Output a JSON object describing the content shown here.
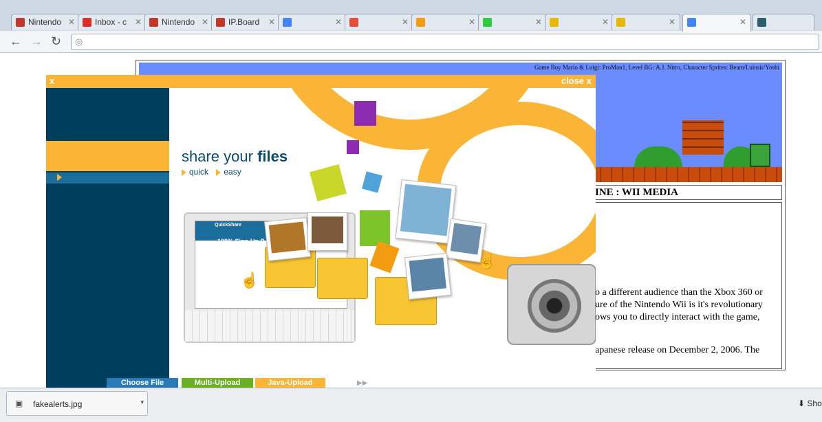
{
  "tabs": [
    {
      "title": "Nintendo",
      "favicon_color": "#c0392b"
    },
    {
      "title": "Inbox - c",
      "favicon_color": "#d93025"
    },
    {
      "title": "Nintendo",
      "favicon_color": "#c0392b"
    },
    {
      "title": "IP.Board",
      "favicon_color": "#c0392b"
    },
    {
      "title": "",
      "favicon_color": "#4285f4"
    },
    {
      "title": "",
      "favicon_color": "#e74c3c"
    },
    {
      "title": "",
      "favicon_color": "#f39c12"
    },
    {
      "title": "",
      "favicon_color": "#2ecc40"
    },
    {
      "title": "",
      "favicon_color": "#e6b800"
    },
    {
      "title": "",
      "favicon_color": "#e6b800"
    },
    {
      "title": "",
      "favicon_color": "#4285f4"
    },
    {
      "title": "",
      "favicon_color": "#2c5f6b"
    }
  ],
  "toolbar": {
    "url": ""
  },
  "webpage": {
    "banner_credit": "Game Boy Mario & Luigi: ProMan1, Level BG: A.J. Nitro, Character Sprites: Beam/Luinsir/Yoshi",
    "section_title": "INE : WII MEDIA",
    "article_lines": [
      "o a different audience than the Xbox 360 or",
      "ure of the Nintendo Wii is it's revolutionary",
      "ows you to directly interact with the game,",
      "apanese release on December 2, 2006. The"
    ]
  },
  "ad": {
    "x_label": "x",
    "close_label": "close x",
    "headline_light": "share your ",
    "headline_bold": "files",
    "tag_quick": "quick",
    "tag_easy": "easy",
    "laptop_brand": "QuickShare",
    "laptop_banner": "100% Sign-Up B",
    "buttons": {
      "choose_file": "Choose File",
      "multi_upload": "Multi-Upload",
      "java_upload": "Java-Upload"
    },
    "colors": {
      "orange": "#fbb536",
      "navy": "#003e5e",
      "green": "#6ab023",
      "blue": "#2a7ab8"
    }
  },
  "downloads": {
    "file_name": "fakealerts.jpg",
    "show_all_label": "Sho"
  }
}
